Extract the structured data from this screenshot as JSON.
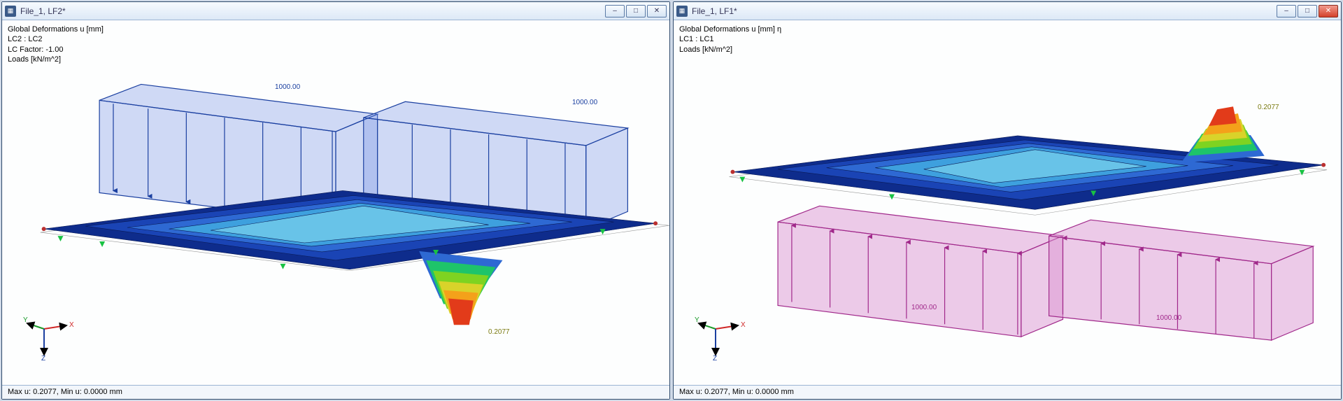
{
  "panes": [
    {
      "title": "File_1, LF2*",
      "overlay": {
        "line1": "Global Deformations u [mm]",
        "line2": "LC2 : LC2",
        "line3": "LC Factor: -1.00",
        "line4": "Loads [kN/m^2]"
      },
      "load_label_1": "1000.00",
      "load_label_2": "1000.00",
      "peak_label": "0.2077",
      "status": "Max u: 0.2077, Min u: 0.0000 mm",
      "axes": {
        "x": "X",
        "y": "Y",
        "z": "Z"
      }
    },
    {
      "title": "File_1, LF1*",
      "overlay": {
        "line1": "Global Deformations u [mm]  η",
        "line2": "LC1 : LC1",
        "line3": "Loads [kN/m^2]"
      },
      "load_label_1": "1000.00",
      "load_label_2": "1000.00",
      "peak_label": "0.2077",
      "status": "Max u: 0.2077, Min u: 0.0000 mm",
      "axes": {
        "x": "X",
        "y": "Y",
        "z": "Z"
      }
    }
  ],
  "win_buttons": {
    "minimize": "–",
    "maximize": "□",
    "close": "✕"
  }
}
